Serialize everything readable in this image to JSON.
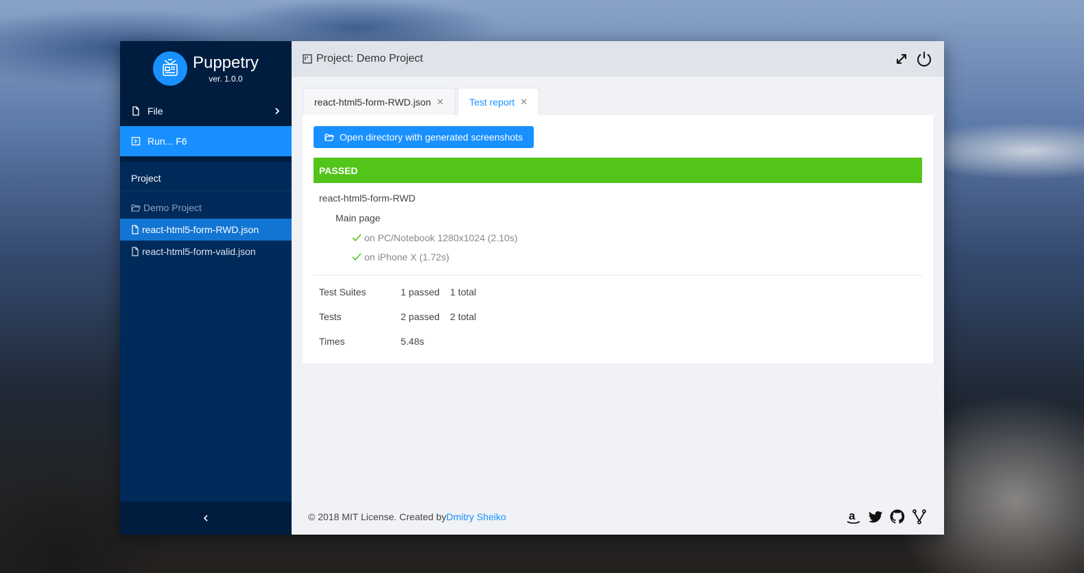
{
  "app": {
    "name": "Puppetry",
    "version": "ver. 1.0.0"
  },
  "sidebar": {
    "menu": [
      {
        "label": "File"
      },
      {
        "label": "Run... F6"
      }
    ],
    "project_heading": "Project",
    "tree": [
      {
        "label": "Demo Project",
        "type": "folder"
      },
      {
        "label": "react-html5-form-RWD.json",
        "type": "file",
        "active": true
      },
      {
        "label": "react-html5-form-valid.json",
        "type": "file"
      }
    ]
  },
  "header": {
    "title": "Project: Demo Project"
  },
  "tabs": [
    {
      "label": "react-html5-form-RWD.json"
    },
    {
      "label": "Test report",
      "active": true
    }
  ],
  "report": {
    "open_button": "Open directory with generated screenshots",
    "status": "PASSED",
    "suite": "react-html5-form-RWD",
    "describe": "Main page",
    "cases": [
      {
        "label": "on PC/Notebook 1280x1024 (2.10s)"
      },
      {
        "label": "on iPhone X (1.72s)"
      }
    ],
    "stats": [
      {
        "label": "Test Suites",
        "v1": "1 passed",
        "v2": "1 total"
      },
      {
        "label": "Tests",
        "v1": "2 passed",
        "v2": "2 total"
      },
      {
        "label": "Times",
        "v1": "5.48s",
        "v2": ""
      }
    ]
  },
  "footer": {
    "text": "© 2018 MIT License. Created by ",
    "author": "Dmitry Sheiko"
  },
  "colors": {
    "accent": "#1890ff",
    "passed": "#52c41a",
    "sidebar": "#002a5a"
  }
}
